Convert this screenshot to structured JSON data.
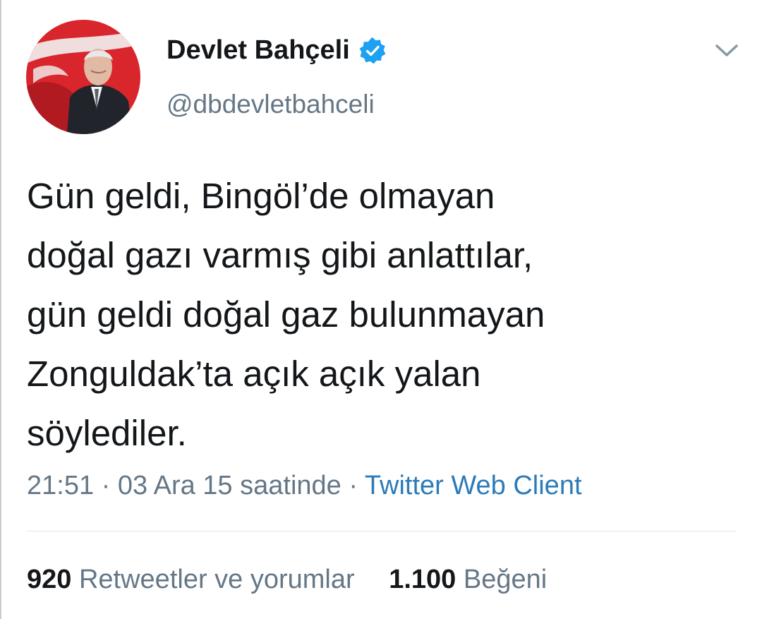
{
  "tweet": {
    "author": {
      "display_name": "Devlet Bahçeli",
      "handle": "@dbdevletbahceli",
      "verified": true
    },
    "text_lines": [
      "Gün geldi, Bingöl’de olmayan",
      "doğal gazı varmış gibi anlattılar,",
      "gün geldi doğal gaz bulunmayan",
      "Zonguldak’ta açık açık yalan",
      "söylediler."
    ],
    "time": "21:51",
    "separator": " · ",
    "date": "03 Ara 15 saatinde",
    "source": "Twitter Web Client",
    "stats": {
      "retweets_count": "920",
      "retweets_label": "Retweetler ve yorumlar",
      "likes_count": "1.100",
      "likes_label": "Beğeni"
    }
  },
  "icons": {
    "verified": "verified-badge-icon",
    "menu": "chevron-down-icon"
  },
  "colors": {
    "verified_blue": "#1da1f2",
    "link_blue": "#2b7bb9",
    "secondary_text": "#657786",
    "primary_text": "#14171a",
    "flag_red": "#d8262c"
  }
}
